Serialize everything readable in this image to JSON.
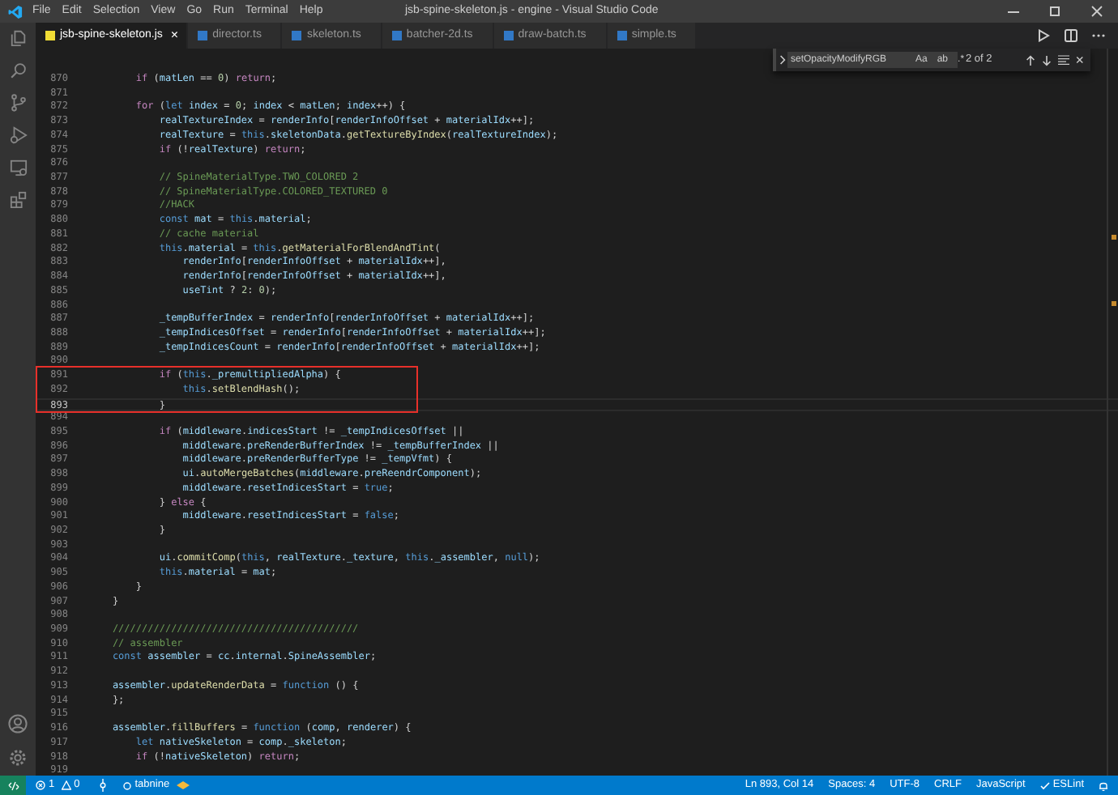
{
  "window": {
    "title": "jsb-spine-skeleton.js - engine - Visual Studio Code"
  },
  "menu": [
    "File",
    "Edit",
    "Selection",
    "View",
    "Go",
    "Run",
    "Terminal",
    "Help"
  ],
  "tabs": [
    {
      "label": "jsb-spine-skeleton.js",
      "kind": "js",
      "selected": true,
      "close": "×"
    },
    {
      "label": "director.ts",
      "kind": "ts",
      "selected": false
    },
    {
      "label": "skeleton.ts",
      "kind": "ts",
      "selected": false
    },
    {
      "label": "batcher-2d.ts",
      "kind": "ts",
      "selected": false
    },
    {
      "label": "draw-batch.ts",
      "kind": "ts",
      "selected": false
    },
    {
      "label": "simple.ts",
      "kind": "ts",
      "selected": false
    }
  ],
  "find": {
    "value": "setOpacityModifyRGB",
    "toggles": [
      {
        "label": "Aa",
        "on": false
      },
      {
        "label": "ab",
        "on": false
      },
      {
        "label": ".*",
        "on": false
      }
    ],
    "result": "2 of 2",
    "close": "×"
  },
  "lines": [
    {
      "n": "870",
      "current": false,
      "boxed": false,
      "s": [
        {
          "kind": "ctl",
          "text": "        if"
        },
        {
          "kind": "txt",
          "text": " ("
        },
        {
          "kind": "var",
          "text": "matLen"
        },
        {
          "kind": "txt",
          "text": " == "
        },
        {
          "kind": "num",
          "text": "0"
        },
        {
          "kind": "txt",
          "text": ") "
        },
        {
          "kind": "ctl",
          "text": "return"
        },
        {
          "kind": "txt",
          "text": ";"
        }
      ]
    },
    {
      "n": "871",
      "current": false,
      "boxed": false
    },
    {
      "n": "872",
      "current": false,
      "boxed": false,
      "s": [
        {
          "kind": "ctl",
          "text": "        for"
        },
        {
          "kind": "txt",
          "text": " ("
        },
        {
          "kind": "kw",
          "text": "let"
        },
        {
          "kind": "var",
          "text": " index"
        },
        {
          "kind": "txt",
          "text": " = "
        },
        {
          "kind": "num",
          "text": "0"
        },
        {
          "kind": "txt",
          "text": "; "
        },
        {
          "kind": "var",
          "text": "index"
        },
        {
          "kind": "txt",
          "text": " < "
        },
        {
          "kind": "var",
          "text": "matLen"
        },
        {
          "kind": "txt",
          "text": "; "
        },
        {
          "kind": "var",
          "text": "index"
        },
        {
          "kind": "txt",
          "text": "++) {"
        }
      ]
    },
    {
      "n": "873",
      "current": false,
      "boxed": false,
      "s": [
        {
          "kind": "var",
          "text": "            realTextureIndex"
        },
        {
          "kind": "txt",
          "text": " = "
        },
        {
          "kind": "var",
          "text": "renderInfo"
        },
        {
          "kind": "txt",
          "text": "["
        },
        {
          "kind": "var",
          "text": "renderInfoOffset"
        },
        {
          "kind": "txt",
          "text": " + "
        },
        {
          "kind": "var",
          "text": "materialIdx"
        },
        {
          "kind": "txt",
          "text": "++];"
        }
      ]
    },
    {
      "n": "874",
      "current": false,
      "boxed": false,
      "s": [
        {
          "kind": "var",
          "text": "            realTexture"
        },
        {
          "kind": "txt",
          "text": " = "
        },
        {
          "kind": "kw",
          "text": "this"
        },
        {
          "kind": "txt",
          "text": "."
        },
        {
          "kind": "var",
          "text": "skeletonData"
        },
        {
          "kind": "txt",
          "text": "."
        },
        {
          "kind": "fn",
          "text": "getTextureByIndex"
        },
        {
          "kind": "txt",
          "text": "("
        },
        {
          "kind": "var",
          "text": "realTextureIndex"
        },
        {
          "kind": "txt",
          "text": ");"
        }
      ]
    },
    {
      "n": "875",
      "current": false,
      "boxed": false,
      "s": [
        {
          "kind": "ctl",
          "text": "            if"
        },
        {
          "kind": "txt",
          "text": " (!"
        },
        {
          "kind": "var",
          "text": "realTexture"
        },
        {
          "kind": "txt",
          "text": ") "
        },
        {
          "kind": "ctl",
          "text": "return"
        },
        {
          "kind": "txt",
          "text": ";"
        }
      ]
    },
    {
      "n": "876",
      "current": false,
      "boxed": false
    },
    {
      "n": "877",
      "current": false,
      "boxed": false,
      "s": [
        {
          "kind": "cmt",
          "text": "            // SpineMaterialType.TWO_COLORED 2"
        }
      ]
    },
    {
      "n": "878",
      "current": false,
      "boxed": false,
      "s": [
        {
          "kind": "cmt",
          "text": "            // SpineMaterialType.COLORED_TEXTURED 0"
        }
      ]
    },
    {
      "n": "879",
      "current": false,
      "boxed": false,
      "s": [
        {
          "kind": "cmt",
          "text": "            //HACK"
        }
      ]
    },
    {
      "n": "880",
      "current": false,
      "boxed": false,
      "s": [
        {
          "kind": "kw",
          "text": "            const"
        },
        {
          "kind": "var",
          "text": " mat"
        },
        {
          "kind": "txt",
          "text": " = "
        },
        {
          "kind": "kw",
          "text": "this"
        },
        {
          "kind": "txt",
          "text": "."
        },
        {
          "kind": "var",
          "text": "material"
        },
        {
          "kind": "txt",
          "text": ";"
        }
      ]
    },
    {
      "n": "881",
      "current": false,
      "boxed": false,
      "s": [
        {
          "kind": "cmt",
          "text": "            // cache material"
        }
      ]
    },
    {
      "n": "882",
      "current": false,
      "boxed": false,
      "s": [
        {
          "kind": "kw",
          "text": "            this"
        },
        {
          "kind": "txt",
          "text": "."
        },
        {
          "kind": "var",
          "text": "material"
        },
        {
          "kind": "txt",
          "text": " = "
        },
        {
          "kind": "kw",
          "text": "this"
        },
        {
          "kind": "txt",
          "text": "."
        },
        {
          "kind": "fn",
          "text": "getMaterialForBlendAndTint"
        },
        {
          "kind": "txt",
          "text": "("
        }
      ]
    },
    {
      "n": "883",
      "current": false,
      "boxed": false,
      "s": [
        {
          "kind": "var",
          "text": "                renderInfo"
        },
        {
          "kind": "txt",
          "text": "["
        },
        {
          "kind": "var",
          "text": "renderInfoOffset"
        },
        {
          "kind": "txt",
          "text": " + "
        },
        {
          "kind": "var",
          "text": "materialIdx"
        },
        {
          "kind": "txt",
          "text": "++],"
        }
      ]
    },
    {
      "n": "884",
      "current": false,
      "boxed": false,
      "s": [
        {
          "kind": "var",
          "text": "                renderInfo"
        },
        {
          "kind": "txt",
          "text": "["
        },
        {
          "kind": "var",
          "text": "renderInfoOffset"
        },
        {
          "kind": "txt",
          "text": " + "
        },
        {
          "kind": "var",
          "text": "materialIdx"
        },
        {
          "kind": "txt",
          "text": "++],"
        }
      ]
    },
    {
      "n": "885",
      "current": false,
      "boxed": false,
      "s": [
        {
          "kind": "var",
          "text": "                useTint"
        },
        {
          "kind": "txt",
          "text": " ? "
        },
        {
          "kind": "num",
          "text": "2"
        },
        {
          "kind": "txt",
          "text": ": "
        },
        {
          "kind": "num",
          "text": "0"
        },
        {
          "kind": "txt",
          "text": ");"
        }
      ]
    },
    {
      "n": "886",
      "current": false,
      "boxed": false
    },
    {
      "n": "887",
      "current": false,
      "boxed": false,
      "s": [
        {
          "kind": "var",
          "text": "            _tempBufferIndex"
        },
        {
          "kind": "txt",
          "text": " = "
        },
        {
          "kind": "var",
          "text": "renderInfo"
        },
        {
          "kind": "txt",
          "text": "["
        },
        {
          "kind": "var",
          "text": "renderInfoOffset"
        },
        {
          "kind": "txt",
          "text": " + "
        },
        {
          "kind": "var",
          "text": "materialIdx"
        },
        {
          "kind": "txt",
          "text": "++];"
        }
      ]
    },
    {
      "n": "888",
      "current": false,
      "boxed": false,
      "s": [
        {
          "kind": "var",
          "text": "            _tempIndicesOffset"
        },
        {
          "kind": "txt",
          "text": " = "
        },
        {
          "kind": "var",
          "text": "renderInfo"
        },
        {
          "kind": "txt",
          "text": "["
        },
        {
          "kind": "var",
          "text": "renderInfoOffset"
        },
        {
          "kind": "txt",
          "text": " + "
        },
        {
          "kind": "var",
          "text": "materialIdx"
        },
        {
          "kind": "txt",
          "text": "++];"
        }
      ]
    },
    {
      "n": "889",
      "current": false,
      "boxed": false,
      "s": [
        {
          "kind": "var",
          "text": "            _tempIndicesCount"
        },
        {
          "kind": "txt",
          "text": " = "
        },
        {
          "kind": "var",
          "text": "renderInfo"
        },
        {
          "kind": "txt",
          "text": "["
        },
        {
          "kind": "var",
          "text": "renderInfoOffset"
        },
        {
          "kind": "txt",
          "text": " + "
        },
        {
          "kind": "var",
          "text": "materialIdx"
        },
        {
          "kind": "txt",
          "text": "++];"
        }
      ]
    },
    {
      "n": "890",
      "current": false,
      "boxed": false
    },
    {
      "n": "891",
      "current": false,
      "boxed": true,
      "s": [
        {
          "kind": "ctl",
          "text": "            if"
        },
        {
          "kind": "txt",
          "text": " ("
        },
        {
          "kind": "kw",
          "text": "this"
        },
        {
          "kind": "txt",
          "text": "."
        },
        {
          "kind": "var",
          "text": "_premultipliedAlpha"
        },
        {
          "kind": "txt",
          "text": ") {"
        }
      ]
    },
    {
      "n": "892",
      "current": false,
      "boxed": true,
      "s": [
        {
          "kind": "kw",
          "text": "                this"
        },
        {
          "kind": "txt",
          "text": "."
        },
        {
          "kind": "fn",
          "text": "setBlendHash"
        },
        {
          "kind": "txt",
          "text": "();"
        }
      ]
    },
    {
      "n": "893",
      "current": true,
      "boxed": true,
      "s": [
        {
          "kind": "txt",
          "text": "            }"
        }
      ]
    },
    {
      "n": "894",
      "current": false,
      "boxed": false
    },
    {
      "n": "895",
      "current": false,
      "boxed": false,
      "s": [
        {
          "kind": "ctl",
          "text": "            if"
        },
        {
          "kind": "txt",
          "text": " ("
        },
        {
          "kind": "var",
          "text": "middleware"
        },
        {
          "kind": "txt",
          "text": "."
        },
        {
          "kind": "var",
          "text": "indicesStart"
        },
        {
          "kind": "txt",
          "text": " != "
        },
        {
          "kind": "var",
          "text": "_tempIndicesOffset"
        },
        {
          "kind": "txt",
          "text": " ||"
        }
      ]
    },
    {
      "n": "896",
      "current": false,
      "boxed": false,
      "s": [
        {
          "kind": "var",
          "text": "                middleware"
        },
        {
          "kind": "txt",
          "text": "."
        },
        {
          "kind": "var",
          "text": "preRenderBufferIndex"
        },
        {
          "kind": "txt",
          "text": " != "
        },
        {
          "kind": "var",
          "text": "_tempBufferIndex"
        },
        {
          "kind": "txt",
          "text": " ||"
        }
      ]
    },
    {
      "n": "897",
      "current": false,
      "boxed": false,
      "s": [
        {
          "kind": "var",
          "text": "                middleware"
        },
        {
          "kind": "txt",
          "text": "."
        },
        {
          "kind": "var",
          "text": "preRenderBufferType"
        },
        {
          "kind": "txt",
          "text": " != "
        },
        {
          "kind": "var",
          "text": "_tempVfmt"
        },
        {
          "kind": "txt",
          "text": ") {"
        }
      ]
    },
    {
      "n": "898",
      "current": false,
      "boxed": false,
      "s": [
        {
          "kind": "var",
          "text": "                ui"
        },
        {
          "kind": "txt",
          "text": "."
        },
        {
          "kind": "fn",
          "text": "autoMergeBatches"
        },
        {
          "kind": "txt",
          "text": "("
        },
        {
          "kind": "var",
          "text": "middleware"
        },
        {
          "kind": "txt",
          "text": "."
        },
        {
          "kind": "var",
          "text": "preReendrComponent"
        },
        {
          "kind": "txt",
          "text": ");"
        }
      ]
    },
    {
      "n": "899",
      "current": false,
      "boxed": false,
      "s": [
        {
          "kind": "var",
          "text": "                middleware"
        },
        {
          "kind": "txt",
          "text": "."
        },
        {
          "kind": "var",
          "text": "resetIndicesStart"
        },
        {
          "kind": "txt",
          "text": " = "
        },
        {
          "kind": "kw",
          "text": "true"
        },
        {
          "kind": "txt",
          "text": ";"
        }
      ]
    },
    {
      "n": "900",
      "current": false,
      "boxed": false,
      "s": [
        {
          "kind": "txt",
          "text": "            } "
        },
        {
          "kind": "ctl",
          "text": "else"
        },
        {
          "kind": "txt",
          "text": " {"
        }
      ]
    },
    {
      "n": "901",
      "current": false,
      "boxed": false,
      "s": [
        {
          "kind": "var",
          "text": "                middleware"
        },
        {
          "kind": "txt",
          "text": "."
        },
        {
          "kind": "var",
          "text": "resetIndicesStart"
        },
        {
          "kind": "txt",
          "text": " = "
        },
        {
          "kind": "kw",
          "text": "false"
        },
        {
          "kind": "txt",
          "text": ";"
        }
      ]
    },
    {
      "n": "902",
      "current": false,
      "boxed": false,
      "s": [
        {
          "kind": "txt",
          "text": "            }"
        }
      ]
    },
    {
      "n": "903",
      "current": false,
      "boxed": false
    },
    {
      "n": "904",
      "current": false,
      "boxed": false,
      "s": [
        {
          "kind": "var",
          "text": "            ui"
        },
        {
          "kind": "txt",
          "text": "."
        },
        {
          "kind": "fn",
          "text": "commitComp"
        },
        {
          "kind": "txt",
          "text": "("
        },
        {
          "kind": "kw",
          "text": "this"
        },
        {
          "kind": "txt",
          "text": ", "
        },
        {
          "kind": "var",
          "text": "realTexture"
        },
        {
          "kind": "txt",
          "text": "."
        },
        {
          "kind": "var",
          "text": "_texture"
        },
        {
          "kind": "txt",
          "text": ", "
        },
        {
          "kind": "kw",
          "text": "this"
        },
        {
          "kind": "txt",
          "text": "."
        },
        {
          "kind": "var",
          "text": "_assembler"
        },
        {
          "kind": "txt",
          "text": ", "
        },
        {
          "kind": "kw",
          "text": "null"
        },
        {
          "kind": "txt",
          "text": ");"
        }
      ]
    },
    {
      "n": "905",
      "current": false,
      "boxed": false,
      "s": [
        {
          "kind": "kw",
          "text": "            this"
        },
        {
          "kind": "txt",
          "text": "."
        },
        {
          "kind": "var",
          "text": "material"
        },
        {
          "kind": "txt",
          "text": " = "
        },
        {
          "kind": "var",
          "text": "mat"
        },
        {
          "kind": "txt",
          "text": ";"
        }
      ]
    },
    {
      "n": "906",
      "current": false,
      "boxed": false,
      "s": [
        {
          "kind": "txt",
          "text": "        }"
        }
      ]
    },
    {
      "n": "907",
      "current": false,
      "boxed": false,
      "s": [
        {
          "kind": "txt",
          "text": "    }"
        }
      ]
    },
    {
      "n": "908",
      "current": false,
      "boxed": false
    },
    {
      "n": "909",
      "current": false,
      "boxed": false,
      "s": [
        {
          "kind": "cmt",
          "text": "    //////////////////////////////////////////"
        }
      ]
    },
    {
      "n": "910",
      "current": false,
      "boxed": false,
      "s": [
        {
          "kind": "cmt",
          "text": "    // assembler"
        }
      ]
    },
    {
      "n": "911",
      "current": false,
      "boxed": false,
      "s": [
        {
          "kind": "kw",
          "text": "    const"
        },
        {
          "kind": "var",
          "text": " assembler"
        },
        {
          "kind": "txt",
          "text": " = "
        },
        {
          "kind": "var",
          "text": "cc"
        },
        {
          "kind": "txt",
          "text": "."
        },
        {
          "kind": "var",
          "text": "internal"
        },
        {
          "kind": "txt",
          "text": "."
        },
        {
          "kind": "var",
          "text": "SpineAssembler"
        },
        {
          "kind": "txt",
          "text": ";"
        }
      ]
    },
    {
      "n": "912",
      "current": false,
      "boxed": false
    },
    {
      "n": "913",
      "current": false,
      "boxed": false,
      "s": [
        {
          "kind": "var",
          "text": "    assembler"
        },
        {
          "kind": "txt",
          "text": "."
        },
        {
          "kind": "fn",
          "text": "updateRenderData"
        },
        {
          "kind": "txt",
          "text": " = "
        },
        {
          "kind": "kw",
          "text": "function"
        },
        {
          "kind": "txt",
          "text": " () {"
        }
      ]
    },
    {
      "n": "914",
      "current": false,
      "boxed": false,
      "s": [
        {
          "kind": "txt",
          "text": "    };"
        }
      ]
    },
    {
      "n": "915",
      "current": false,
      "boxed": false
    },
    {
      "n": "916",
      "current": false,
      "boxed": false,
      "s": [
        {
          "kind": "var",
          "text": "    assembler"
        },
        {
          "kind": "txt",
          "text": "."
        },
        {
          "kind": "fn",
          "text": "fillBuffers"
        },
        {
          "kind": "txt",
          "text": " = "
        },
        {
          "kind": "kw",
          "text": "function"
        },
        {
          "kind": "txt",
          "text": " ("
        },
        {
          "kind": "var",
          "text": "comp"
        },
        {
          "kind": "txt",
          "text": ", "
        },
        {
          "kind": "var",
          "text": "renderer"
        },
        {
          "kind": "txt",
          "text": ") {"
        }
      ]
    },
    {
      "n": "917",
      "current": false,
      "boxed": false,
      "s": [
        {
          "kind": "kw",
          "text": "        let"
        },
        {
          "kind": "var",
          "text": " nativeSkeleton"
        },
        {
          "kind": "txt",
          "text": " = "
        },
        {
          "kind": "var",
          "text": "comp"
        },
        {
          "kind": "txt",
          "text": "."
        },
        {
          "kind": "var",
          "text": "_skeleton"
        },
        {
          "kind": "txt",
          "text": ";"
        }
      ]
    },
    {
      "n": "918",
      "current": false,
      "boxed": false,
      "s": [
        {
          "kind": "ctl",
          "text": "        if"
        },
        {
          "kind": "txt",
          "text": " (!"
        },
        {
          "kind": "var",
          "text": "nativeSkeleton"
        },
        {
          "kind": "txt",
          "text": ") "
        },
        {
          "kind": "ctl",
          "text": "return"
        },
        {
          "kind": "txt",
          "text": ";"
        }
      ]
    },
    {
      "n": "919",
      "current": false,
      "boxed": false
    }
  ],
  "status_bar": {
    "errors": "1",
    "warnings": "0",
    "tabnine": "tabnine",
    "right": [
      "Ln 893, Col 14",
      "Spaces: 4",
      "UTF-8",
      "CRLF",
      "JavaScript"
    ],
    "eslint": "ESLint"
  }
}
